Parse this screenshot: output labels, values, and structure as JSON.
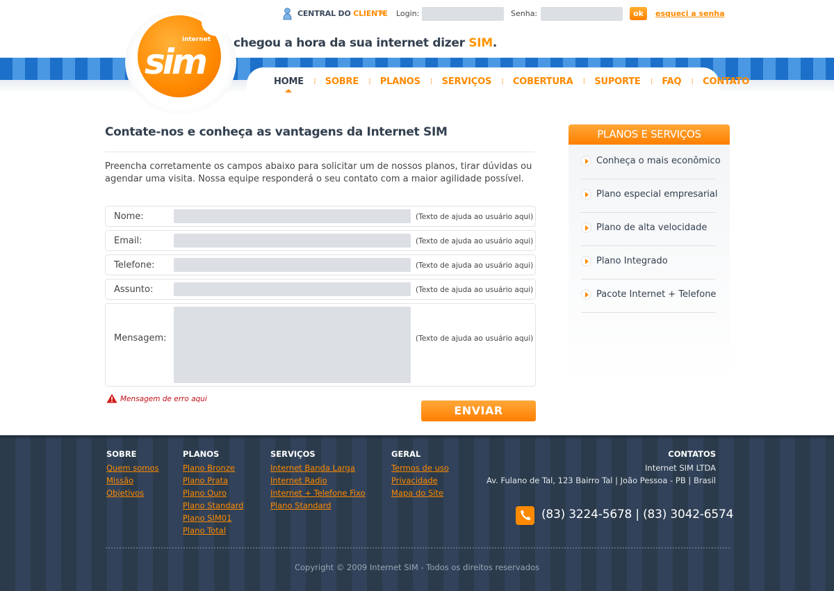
{
  "topbar": {
    "central_prefix": "CENTRAL DO",
    "central_highlight": "CLIENTE",
    "login_label": "Login:",
    "senha_label": "Senha:",
    "ok_label": "ok",
    "forgot_label": "esqueci a senha"
  },
  "brand": {
    "logo_text": "sim",
    "logo_subtext": "internet",
    "slogan_prefix": "chegou a hora da sua internet dizer",
    "slogan_highlight": "SIM",
    "slogan_suffix": ".",
    "accent_color": "#ff8a00",
    "dark_text_color": "#33404f"
  },
  "nav": {
    "items": [
      {
        "label": "HOME",
        "active": true
      },
      {
        "label": "SOBRE"
      },
      {
        "label": "PLANOS"
      },
      {
        "label": "SERVIÇOS"
      },
      {
        "label": "COBERTURA"
      },
      {
        "label": "SUPORTE"
      },
      {
        "label": "FAQ"
      },
      {
        "label": "CONTATO"
      }
    ],
    "separator": "⁝"
  },
  "main": {
    "title": "Contate-nos e conheça as vantagens da Internet SIM",
    "intro": "Preencha corretamente os campos abaixo para solicitar um de nossos planos, tirar dúvidas ou agendar uma visita. Nossa equipe responderá o seu contato com a maior agilidade possível.",
    "form": {
      "fields": [
        {
          "label": "Nome:",
          "help": "(Texto de ajuda ao usuário aqui)"
        },
        {
          "label": "Email:",
          "help": "(Texto de ajuda ao usuário aqui)"
        },
        {
          "label": "Telefone:",
          "help": "(Texto de ajuda ao usuário aqui)"
        },
        {
          "label": "Assunto:",
          "help": "(Texto de ajuda ao usuário aqui)"
        },
        {
          "label": "Mensagem:",
          "help": "(Texto de ajuda ao usuário aqui)"
        }
      ],
      "error_message": "Mensagem de erro aqui",
      "submit_label": "ENVIAR"
    }
  },
  "sidebar": {
    "title": "PLANOS E SERVIÇOS",
    "items": [
      {
        "label": "Conheça o mais econômico"
      },
      {
        "label": "Plano especial empresarial"
      },
      {
        "label": "Plano de alta velocidade"
      },
      {
        "label": "Plano Integrado"
      },
      {
        "label": "Pacote Internet + Telefone"
      }
    ]
  },
  "footer": {
    "columns": [
      {
        "title": "SOBRE",
        "links": [
          "Quem somos",
          "Missão",
          "Objetivos"
        ]
      },
      {
        "title": "PLANOS",
        "links": [
          "Plano Bronze",
          "Plano Prata",
          "Plano Ouro",
          "Plano Standard",
          "Plano SIM01",
          "Plano Total"
        ]
      },
      {
        "title": "SERVIÇOS",
        "links": [
          "Internet Banda Larga",
          "Internet Radio",
          "Internet + Telefone Fixo",
          "Plano Standard"
        ]
      },
      {
        "title": "GERAL",
        "links": [
          "Termos de uso",
          "Privacidade",
          "Mapa do Site"
        ]
      }
    ],
    "contacts": {
      "title": "CONTATOS",
      "company": "Internet SIM LTDA",
      "address": "Av. Fulano de Tal, 123 Bairro Tal | João Pessoa - PB | Brasil",
      "phones": "(83) 3224-5678 | (83) 3042-6574"
    },
    "copyright": "Copyright © 2009 Internet SIM - Todos os direitos reservados"
  }
}
